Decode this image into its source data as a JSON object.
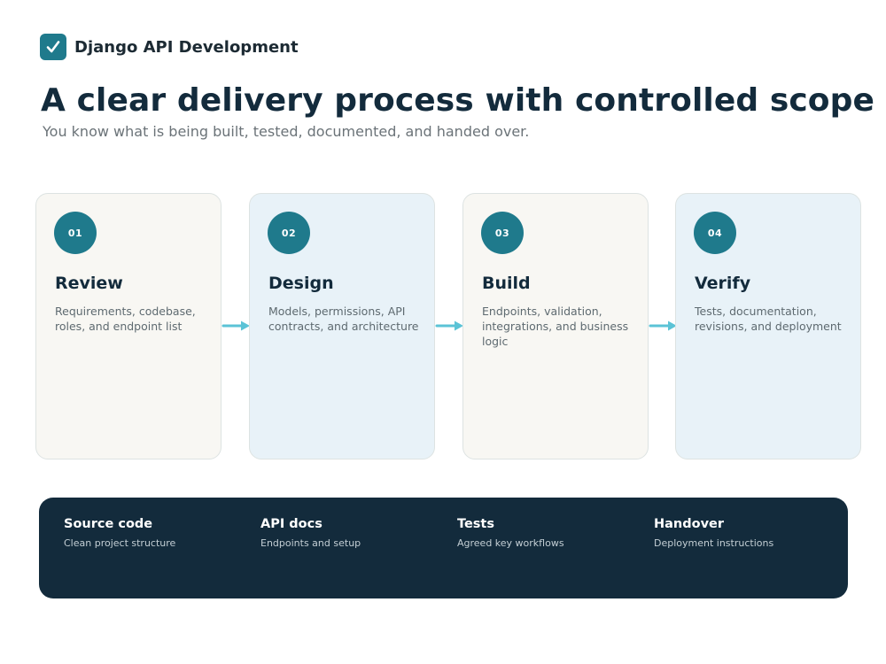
{
  "brand": {
    "name": "Django API Development",
    "icon": "checkbox-check-icon",
    "color": "#1f7a8c"
  },
  "header": {
    "title": "A clear delivery process with controlled scope",
    "subtitle": "You know what is being built, tested, documented, and handed over."
  },
  "steps": [
    {
      "number": "01",
      "title": "Review",
      "description": "Requirements, codebase, roles, and endpoint list"
    },
    {
      "number": "02",
      "title": "Design",
      "description": "Models, permissions, API contracts, and architecture"
    },
    {
      "number": "03",
      "title": "Build",
      "description": "Endpoints, validation, integrations, and business logic"
    },
    {
      "number": "04",
      "title": "Verify",
      "description": "Tests, documentation, revisions, and deployment"
    }
  ],
  "deliverables": [
    {
      "title": "Source code",
      "description": "Clean project structure"
    },
    {
      "title": "API docs",
      "description": "Endpoints and setup"
    },
    {
      "title": "Tests",
      "description": "Agreed key workflows"
    },
    {
      "title": "Handover",
      "description": "Deployment instructions"
    }
  ],
  "colors": {
    "accent": "#1f7a8c",
    "navy": "#132b3c",
    "arrow": "#5bc3d6"
  }
}
